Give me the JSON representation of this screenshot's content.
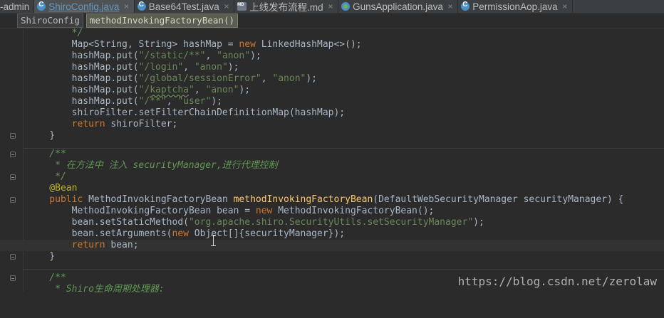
{
  "tabs": [
    {
      "label": "-admin",
      "icon": "none",
      "active": false
    },
    {
      "label": "ShiroConfig.java",
      "icon": "java-class-icon",
      "active": true
    },
    {
      "label": "Base64Test.java",
      "icon": "java-class-icon",
      "active": false
    },
    {
      "label": "上线发布流程.md",
      "icon": "markdown-file-icon",
      "active": false
    },
    {
      "label": "GunsApplication.java",
      "icon": "spring-boot-class-icon",
      "active": false
    },
    {
      "label": "PermissionAop.java",
      "icon": "java-class-icon",
      "active": false
    }
  ],
  "close_glyph": "×",
  "breadcrumb": [
    "ShiroConfig",
    "methodInvokingFactoryBean()"
  ],
  "code": {
    "l1": "        */",
    "l2_a": "        Map<String, String> hashMap = ",
    "l2_kw": "new",
    "l2_b": " LinkedHashMap<>();",
    "put": "        hashMap.put(",
    "anon": "\"anon\"",
    "user": "\"user\"",
    "close": ");",
    "comma": ", ",
    "p1": "\"/static/**\"",
    "p2": "\"/login\"",
    "p3": "\"/global/sessionError\"",
    "p4_a": "\"/",
    "p4_typo": "kaptcha",
    "p4_b": "\"",
    "p5": "\"/**\"",
    "l8": "        shiroFilter.setFilterChainDefinitionMap(hashMap);",
    "l9_kw": "        return",
    "l9_b": " shiroFilter;",
    "brace": "    }",
    "c1": "    /**",
    "c2_a": "     * 在方法中 注入 ",
    "c2_tag": "securityManager",
    "c2_b": ",进行代理控制",
    "c3": "     */",
    "annotation": "    @Bean",
    "sig_kw": "    public",
    "sig_type": " MethodInvokingFactoryBean ",
    "sig_fn": "methodInvokingFactoryBean",
    "sig_params": "(DefaultWebSecurityManager securityManager) {",
    "b1_a": "        MethodInvokingFactoryBean bean = ",
    "b1_kw": "new",
    "b1_b": " MethodInvokingFactoryBean();",
    "b2_a": "        bean.setStaticMethod(",
    "b2_str": "\"org.apache.shiro.SecurityUtils.setSecurityManager\"",
    "b2_b": ");",
    "b3_a": "        bean.setArguments(",
    "b3_kw": "new",
    "b3_b": " Object[]{securityManager});",
    "b4_kw": "        return",
    "b4_b": " bean;",
    "c4": "    /**",
    "c5": "     * Shiro生命周期处理器:"
  },
  "watermark": "https://blog.csdn.net/zerolaw",
  "colors": {
    "keyword": "#cc7832",
    "string": "#6a8759",
    "method": "#ffc66d",
    "annotation": "#bbb529",
    "comment": "#629755",
    "text": "#a9b7c6",
    "background": "#2b2b2b"
  }
}
